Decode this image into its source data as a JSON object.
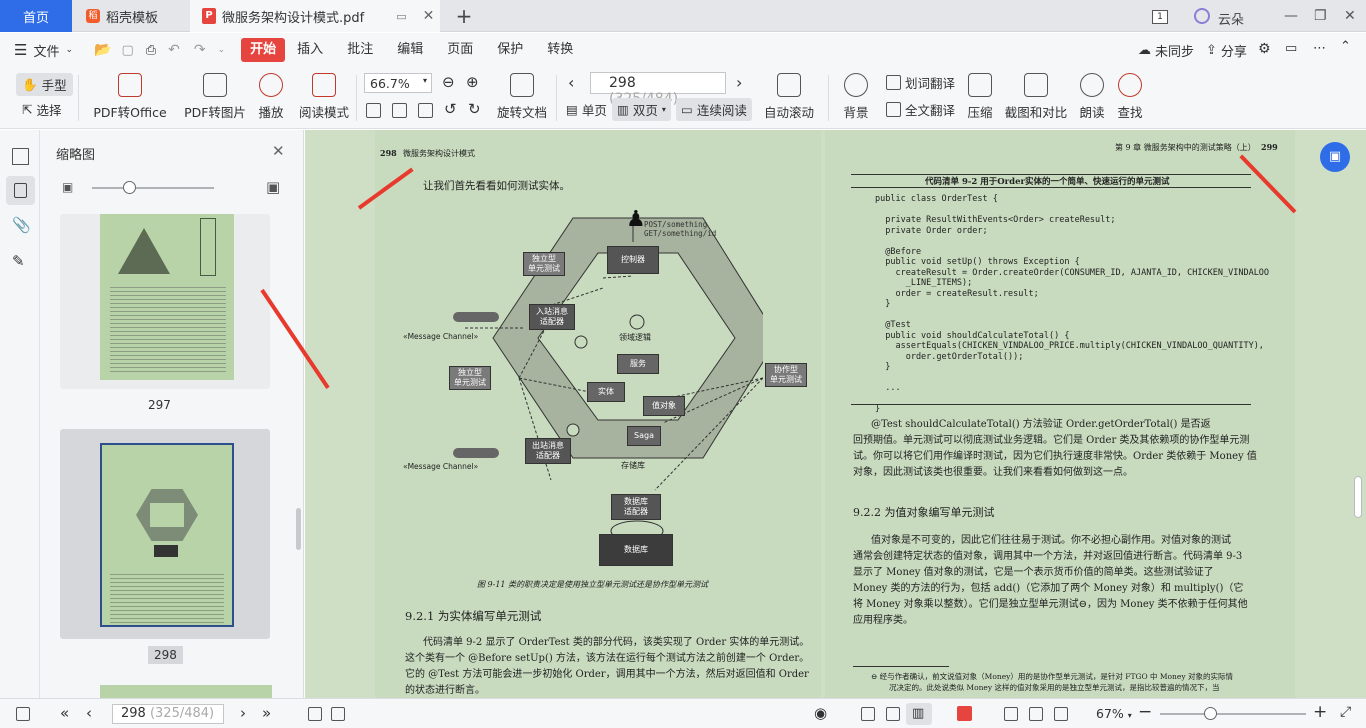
{
  "tabs": {
    "home": "首页",
    "template": "稻壳模板",
    "document": "微服务架构设计模式.pdf",
    "add": "+"
  },
  "window": {
    "page_count_badge": "1",
    "user": "云朵"
  },
  "menu": {
    "file": "文件",
    "items": [
      "开始",
      "插入",
      "批注",
      "编辑",
      "页面",
      "保护",
      "转换"
    ],
    "sync": "未同步",
    "share": "分享"
  },
  "toolbar": {
    "hand": "手型",
    "select": "选择",
    "pdf_to_office": "PDF转Office",
    "pdf_to_image": "PDF转图片",
    "play": "播放",
    "read_mode": "阅读模式",
    "zoom": "66.7%",
    "rotate": "旋转文档",
    "page_input": "298",
    "page_total": "(325/484)",
    "single_page": "单页",
    "double_page": "双页",
    "continuous": "连续阅读",
    "auto_scroll": "自动滚动",
    "background": "背景",
    "word_translate": "划词翻译",
    "full_translate": "全文翻译",
    "compress": "压缩",
    "screenshot_compare": "截图和对比",
    "read_aloud": "朗读",
    "search": "查找"
  },
  "thumbnails": {
    "title": "缩略图",
    "pages": [
      "297",
      "298"
    ]
  },
  "page298": {
    "header_num": "298",
    "header_title": "微服务架构设计模式",
    "intro": "让我们首先看看如何测试实体。",
    "diagram": {
      "controller": "控制器",
      "standalone_top": "独立型\n单元测试",
      "post": "POST/something",
      "get": "GET/something/id",
      "inbound": "入站消息\n适配器",
      "domain_logic": "领域逻辑",
      "service": "服务",
      "entity": "实体",
      "value_object": "值对象",
      "saga": "Saga",
      "repository": "存储库",
      "message_channel_1": "«Message Channel»",
      "message_channel_2": "«Message Channel»",
      "standalone_left": "独立型\n单元测试",
      "collab": "协作型\n单元测试",
      "outbound": "出站消息\n适配器",
      "db_adapter": "数据库\n适配器",
      "database": "数据库"
    },
    "caption": "图 9-11   类的职责决定是使用独立型单元测试还是协作型单元测试",
    "section": "9.2.1   为实体编写单元测试",
    "para1": "代码清单 9-2 显示了 OrderTest 类的部分代码，该类实现了 Order 实体的单元测试。",
    "para2": "这个类有一个 @Before setUp() 方法，该方法在运行每个测试方法之前创建一个 Order。",
    "para3": "它的 @Test 方法可能会进一步初始化 Order，调用其中一个方法，然后对返回值和 Order",
    "para4": "的状态进行断言。"
  },
  "page299": {
    "header_chapter": "第 9 章   微服务架构中的测试策略（上）",
    "header_num": "299",
    "listing_title": "代码清单 9-2   用于Order实体的一个简单、快速运行的单元测试",
    "code": "public class OrderTest {\n\n  private ResultWithEvents<Order> createResult;\n  private Order order;\n\n  @Before\n  public void setUp() throws Exception {\n    createResult = Order.createOrder(CONSUMER_ID, AJANTA_ID, CHICKEN_VINDALOO\n      _LINE_ITEMS);\n    order = createResult.result;\n  }\n\n  @Test\n  public void shouldCalculateTotal() {\n    assertEquals(CHICKEN_VINDALOO_PRICE.multiply(CHICKEN_VINDALOO_QUANTITY),\n      order.getOrderTotal());\n  }\n\n  ...\n\n}",
    "p1": "@Test shouldCalculateTotal() 方法验证 Order.getOrderTotal() 是否返",
    "p2": "回预期值。单元测试可以彻底测试业务逻辑。它们是 Order 类及其依赖项的协作型单元测",
    "p3": "试。你可以将它们用作编译时测试，因为它们执行速度非常快。Order 类依赖于 Money 值",
    "p4": "对象，因此测试该类也很重要。让我们来看看如何做到这一点。",
    "section": "9.2.2   为值对象编写单元测试",
    "q1": "值对象是不可变的，因此它们往往易于测试。你不必担心副作用。对值对象的测试",
    "q2": "通常会创建特定状态的值对象，调用其中一个方法，并对返回值进行断言。代码清单 9-3",
    "q3": "显示了 Money 值对象的测试，它是一个表示货币价值的简单类。这些测试验证了",
    "q4": "Money 类的方法的行为，包括 add()（它添加了两个 Money 对象）和 multiply()（它",
    "q5": "将 Money 对象乘以整数）。它们是独立型单元测试⊖，因为 Money 类不依赖于任何其他",
    "q6": "应用程序类。",
    "fn1": "⊖   经与作者确认，前文说值对象（Money）用的是协作型单元测试，是针对 FTGO 中 Money 对象的实际情",
    "fn2": "况决定的。此处说类似 Money 这样的值对象采用的是独立型单元测试，是指比较普遍的情况下，当"
  },
  "status": {
    "page_input": "298",
    "page_total": "(325/484)",
    "zoom": "67%"
  }
}
